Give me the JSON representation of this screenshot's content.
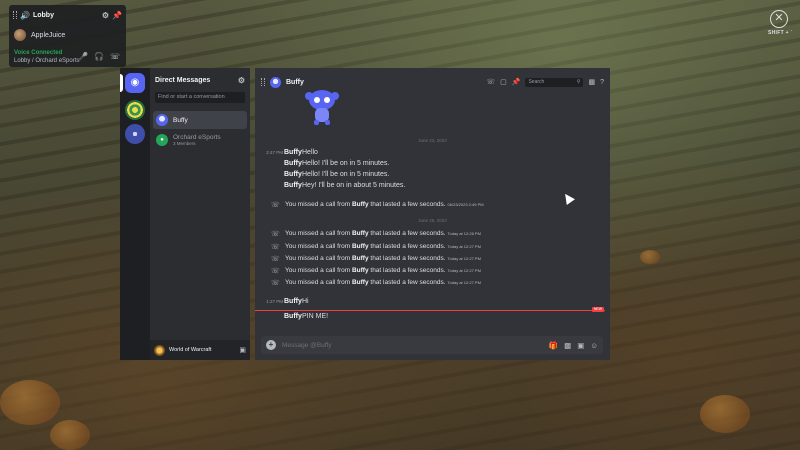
{
  "voice_overlay": {
    "channel_title": "Lobby",
    "user_name": "AppleJuice",
    "status": "Voice Connected",
    "location": "Lobby / Orchard eSports",
    "icons": [
      "speaker-icon",
      "gear-icon",
      "pin-icon",
      "microphone-icon",
      "headphones-icon",
      "disconnect-icon"
    ]
  },
  "overlay_exit": {
    "hint": "SHIFT + `"
  },
  "sidebar": {
    "title": "Direct Messages",
    "search_placeholder": "Find or start a conversation",
    "items": [
      {
        "name": "Buffy",
        "subtitle": "",
        "active": true
      },
      {
        "name": "Orchard eSports",
        "subtitle": "3 Members",
        "active": false
      }
    ],
    "footer_game": "World of Warcraft"
  },
  "chat": {
    "title": "Buffy",
    "search_placeholder": "Search",
    "composer_placeholder": "Message @Buffy",
    "date_1": "June 23, 2023",
    "date_2": "June 26, 2023",
    "messages_day1": [
      {
        "time": "2:47 PM",
        "author": "Buffy",
        "text": "Hello"
      },
      {
        "time": "",
        "author": "Buffy",
        "text": "Hello! I'll be on in 5 minutes."
      },
      {
        "time": "",
        "author": "Buffy",
        "text": "Hello! I'll be on in 5 minutes."
      },
      {
        "time": "",
        "author": "Buffy",
        "text": "Hey! I'll be on in about 5 minutes."
      }
    ],
    "missed_call_prefix": "You missed a call from",
    "missed_call_caller": "Buffy",
    "missed_call_suffix": "that lasted a few seconds.",
    "missed_call_day1_ts": "06/23/2023 2:49 PM",
    "missed_calls_day2_ts": [
      "Today at 12:26 PM",
      "Today at 12:27 PM",
      "Today at 12:27 PM",
      "Today at 12:27 PM",
      "Today at 12:27 PM"
    ],
    "messages_day2": [
      {
        "time": "1:27 PM",
        "author": "Buffy",
        "text": "Hi"
      },
      {
        "time": "",
        "author": "Buffy",
        "text": "PIN ME!"
      }
    ],
    "new_badge": "NEW"
  },
  "colors": {
    "accent": "#5865f2",
    "online": "#23a55a",
    "new_marker": "#f23f43"
  }
}
